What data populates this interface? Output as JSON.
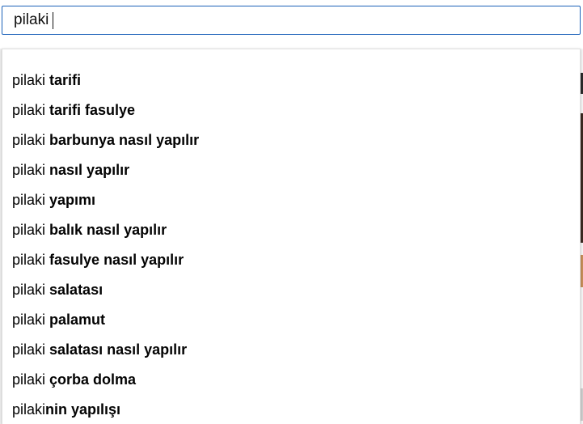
{
  "search": {
    "value": "pilaki"
  },
  "suggestions": [
    {
      "query": "pilaki",
      "completion": " tarifi"
    },
    {
      "query": "pilaki",
      "completion": " tarifi fasulye"
    },
    {
      "query": "pilaki",
      "completion": " barbunya nasıl yapılır"
    },
    {
      "query": "pilaki",
      "completion": " nasıl yapılır"
    },
    {
      "query": "pilaki",
      "completion": " yapımı"
    },
    {
      "query": "pilaki",
      "completion": " balık nasıl yapılır"
    },
    {
      "query": "pilaki",
      "completion": " fasulye nasıl yapılır"
    },
    {
      "query": "pilaki",
      "completion": " salatası"
    },
    {
      "query": "pilaki",
      "completion": " palamut"
    },
    {
      "query": "pilaki",
      "completion": " salatası nasıl yapılır"
    },
    {
      "query": "pilaki",
      "completion": " çorba dolma"
    },
    {
      "query": "pilaki",
      "completion": "nin yapılışı"
    }
  ],
  "colors": {
    "focus_border": "#1c62b9",
    "text": "#030303"
  }
}
